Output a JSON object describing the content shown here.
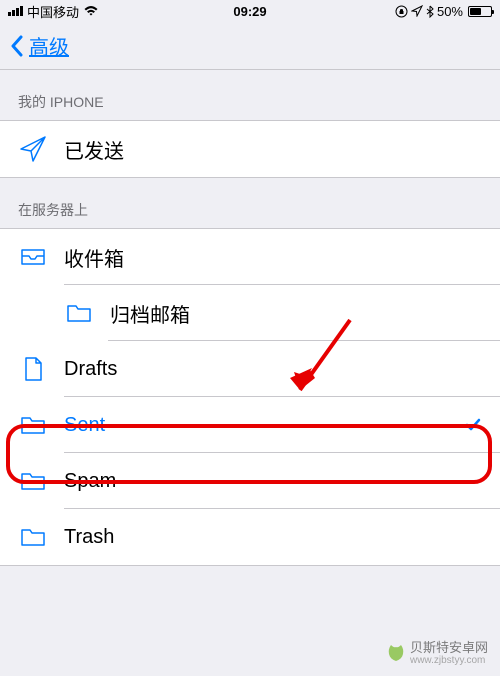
{
  "status": {
    "carrier": "中国移动",
    "time": "09:29",
    "battery_percent": "50%"
  },
  "nav": {
    "back_label": "高级"
  },
  "sections": {
    "my_iphone": {
      "header": "我的 IPHONE",
      "items": {
        "sent_local": "已发送"
      }
    },
    "on_server": {
      "header": "在服务器上",
      "items": {
        "inbox": "收件箱",
        "archive": "归档邮箱",
        "drafts": "Drafts",
        "sent": "Sent",
        "spam": "Spam",
        "trash": "Trash"
      }
    }
  },
  "watermark": {
    "name": "贝斯特安卓网",
    "url": "www.zjbstyy.com"
  }
}
